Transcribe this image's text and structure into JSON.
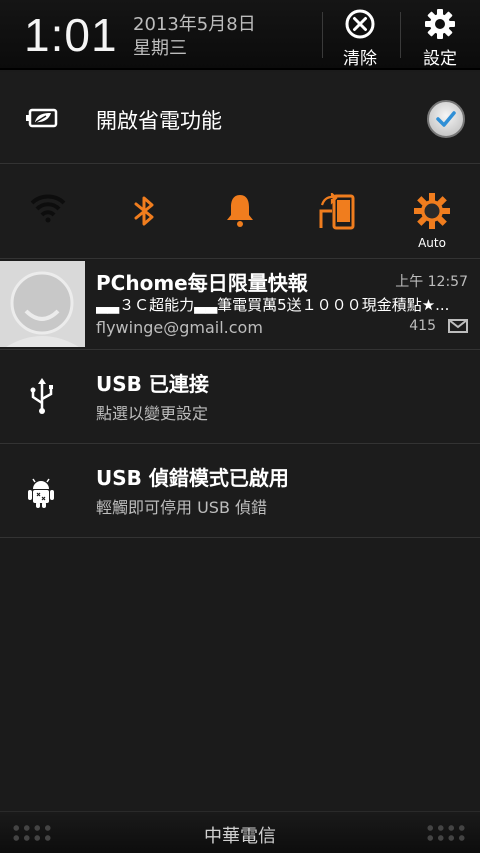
{
  "header": {
    "time": "1:01",
    "date": "2013年5月8日",
    "weekday": "星期三",
    "clear_label": "清除",
    "settings_label": "設定"
  },
  "power_saver": {
    "label": "開啟省電功能",
    "checked": true
  },
  "toggles": [
    {
      "name": "wifi",
      "state": "off"
    },
    {
      "name": "bluetooth",
      "state": "on"
    },
    {
      "name": "sound",
      "state": "on"
    },
    {
      "name": "auto-rotate",
      "state": "on"
    },
    {
      "name": "brightness",
      "state": "on",
      "label": "Auto"
    }
  ],
  "notifications": [
    {
      "title": "PChome每日限量快報",
      "time": "上午 12:57",
      "subject": "▃▃３Ｃ超能力▃▃筆電買萬5送１０００現金積點★...",
      "account": "flywinge@gmail.com",
      "count": "415"
    },
    {
      "title": "USB 已連接",
      "subtitle": "點選以變更設定"
    },
    {
      "title": "USB 偵錯模式已啟用",
      "subtitle": "輕觸即可停用 USB 偵錯"
    }
  ],
  "footer": {
    "carrier": "中華電信"
  },
  "colors": {
    "accent_orange": "#f07d1e",
    "check_blue": "#2f8fd6",
    "background": "#1b1b1b"
  }
}
